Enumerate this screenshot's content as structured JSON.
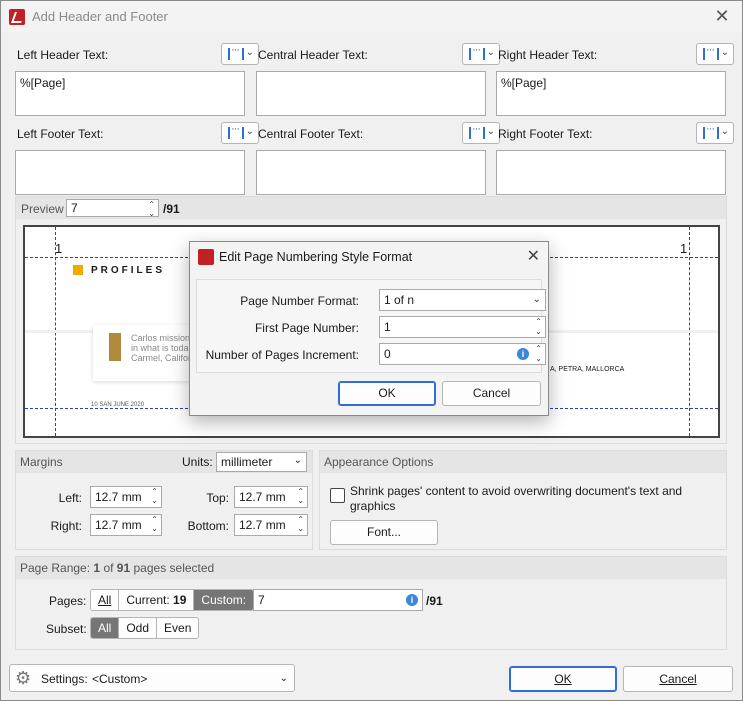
{
  "window": {
    "title": "Add Header and Footer"
  },
  "header": {
    "left_label": "Left Header Text:",
    "left_value": "%[Page]",
    "center_label": "Central Header Text:",
    "center_value": "",
    "right_label": "Right Header Text:",
    "right_value": "%[Page]"
  },
  "footer": {
    "left_label": "Left Footer Text:",
    "left_value": "",
    "center_label": "Central Footer Text:",
    "center_value": "",
    "right_label": "Right Footer Text:",
    "right_value": ""
  },
  "preview": {
    "label": "Preview",
    "page_value": "7",
    "total": "/91",
    "left_page_mark": "1",
    "right_page_mark": "1",
    "profiles": "PROFILES",
    "body_line1": "Carlos mission",
    "body_line2": "in what is toda",
    "body_line3": "Carmel, Califor",
    "right_caption": "A, PETRA, MALLORCA",
    "footer_text": "10  SAN JUNE 2020"
  },
  "margins": {
    "title": "Margins",
    "units_label": "Units:",
    "units_value": "millimeter",
    "left_label": "Left:",
    "left_value": "12.7 mm",
    "right_label": "Right:",
    "right_value": "12.7 mm",
    "top_label": "Top:",
    "top_value": "12.7 mm",
    "bottom_label": "Bottom:",
    "bottom_value": "12.7 mm"
  },
  "appearance": {
    "title": "Appearance Options",
    "shrink_line1": "Shrink pages' content to avoid overwriting document's text and",
    "shrink_line2": "graphics",
    "font_button": "Font..."
  },
  "page_range": {
    "title_prefix": "Page Range:",
    "selected": "1",
    "of": "of",
    "total": "91",
    "suffix": "pages selected",
    "pages_label": "Pages:",
    "btn_all": "All",
    "btn_current_prefix": "Current:",
    "btn_current_value": "19",
    "btn_custom": "Custom:",
    "custom_value": "7",
    "custom_total": "/91",
    "subset_label": "Subset:",
    "subset_all": "All",
    "subset_odd": "Odd",
    "subset_even": "Even"
  },
  "footer_bar": {
    "settings_label": "Settings:",
    "settings_value": "<Custom>",
    "ok": "OK",
    "cancel": "Cancel"
  },
  "modal": {
    "title": "Edit Page Numbering Style Format",
    "format_label": "Page Number Format:",
    "format_value": "1 of n",
    "first_label": "First Page Number:",
    "first_value": "1",
    "increment_label": "Number of Pages Increment:",
    "increment_value": "0",
    "ok": "OK",
    "cancel": "Cancel"
  },
  "colors": {
    "accent": "#2f6fd1",
    "guide": "#2a3fb0",
    "brand": "#c32026"
  }
}
